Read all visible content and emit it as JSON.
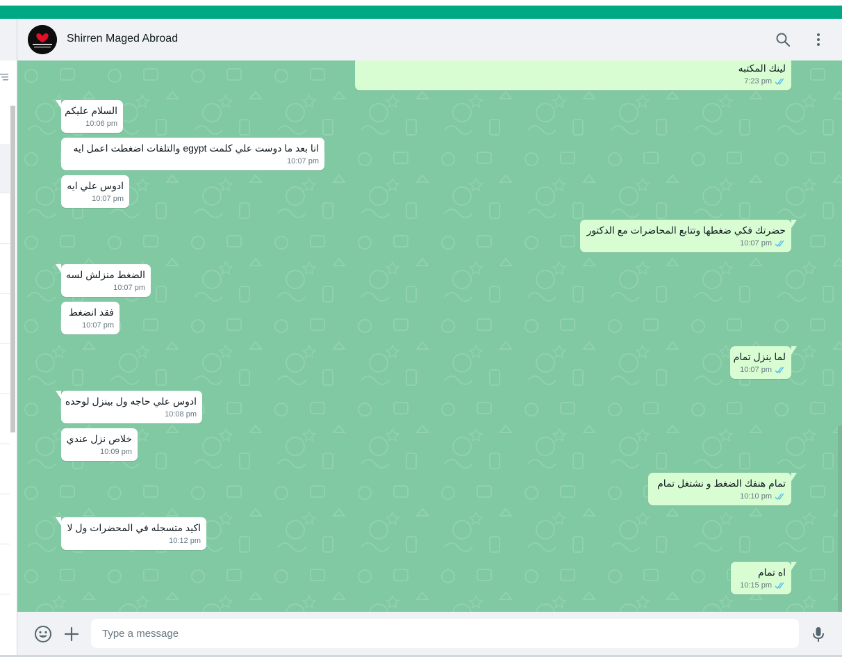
{
  "header": {
    "contact_name": "Shirren Maged Abroad",
    "icons": [
      "search-icon",
      "menu-dots-icon"
    ]
  },
  "colors": {
    "accent": "#00a884",
    "chat_background": "#81c9a2",
    "incoming_bubble": "#ffffff",
    "outgoing_bubble": "#d9fdd3",
    "read_ticks": "#53bdeb"
  },
  "messages": [
    {
      "direction": "out",
      "text": "لينك المكتبه",
      "time": "7:23 pm",
      "status": "read"
    },
    {
      "direction": "in",
      "text": "السلام عليكم",
      "time": "10:06 pm"
    },
    {
      "direction": "in",
      "text": "انا بعد ما دوست علي كلمت egypt  والتلفات اضغطت اعمل ايه",
      "time": "10:07 pm"
    },
    {
      "direction": "in",
      "text": "ادوس علي ايه",
      "time": "10:07 pm"
    },
    {
      "direction": "out",
      "text": "حضرتك فكي ضغطها وتتابع المحاضرات مع الدكتور",
      "time": "10:07 pm",
      "status": "read"
    },
    {
      "direction": "in",
      "text": "الضغط منزلش لسه",
      "time": "10:07 pm"
    },
    {
      "direction": "in",
      "text": "فقد انضغط",
      "time": "10:07 pm"
    },
    {
      "direction": "out",
      "text": "لما ينزل تمام",
      "time": "10:07 pm",
      "status": "read"
    },
    {
      "direction": "in",
      "text": "ادوس علي حاجه ول بينزل لوحده",
      "time": "10:08 pm"
    },
    {
      "direction": "in",
      "text": "خلاص نزل عندي",
      "time": "10:09 pm"
    },
    {
      "direction": "out",
      "text": "تمام هنفك الضغط و نشتغل تمام",
      "time": "10:10 pm",
      "status": "read"
    },
    {
      "direction": "in",
      "text": "اكيد  متسجله في المحضرات ول لا",
      "time": "10:12 pm"
    },
    {
      "direction": "out",
      "text": "اه تمام",
      "time": "10:15 pm",
      "status": "read"
    }
  ],
  "composer": {
    "placeholder": "Type a message",
    "icons": [
      "emoji-icon",
      "attach-plus-icon",
      "microphone-icon"
    ]
  }
}
